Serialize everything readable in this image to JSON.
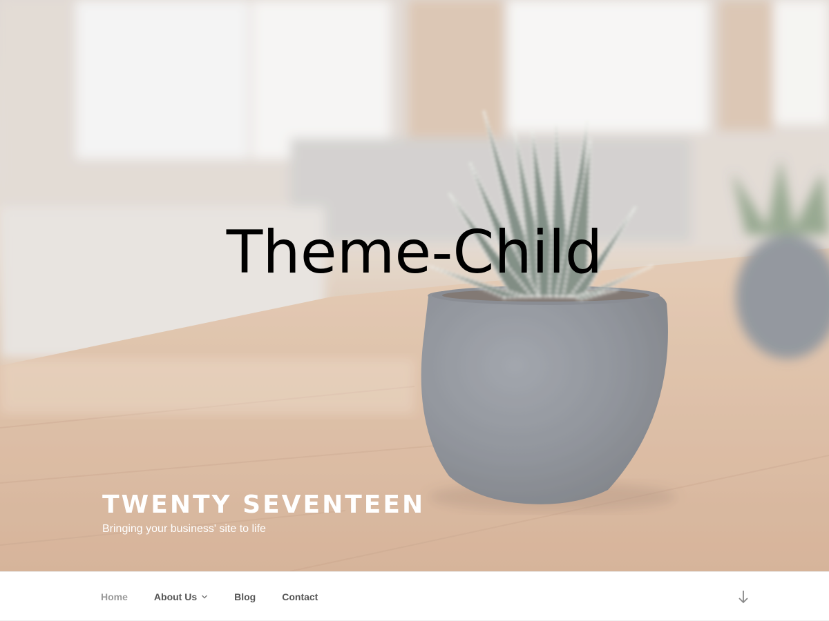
{
  "hero": {
    "overlay_title": "Theme-Child"
  },
  "site": {
    "title": "Twenty Seventeen",
    "description": "Bringing your business' site to life"
  },
  "nav": {
    "items": [
      {
        "label": "Home",
        "current": true
      },
      {
        "label": "About Us",
        "has_submenu": true
      },
      {
        "label": "Blog"
      },
      {
        "label": "Contact"
      }
    ],
    "submenu_icon": "chevron-down-icon",
    "scroll_icon": "arrow-down-icon"
  },
  "colors": {
    "nav_text": "#555555",
    "nav_current": "#9a9a9a",
    "site_title": "#ffffff"
  }
}
